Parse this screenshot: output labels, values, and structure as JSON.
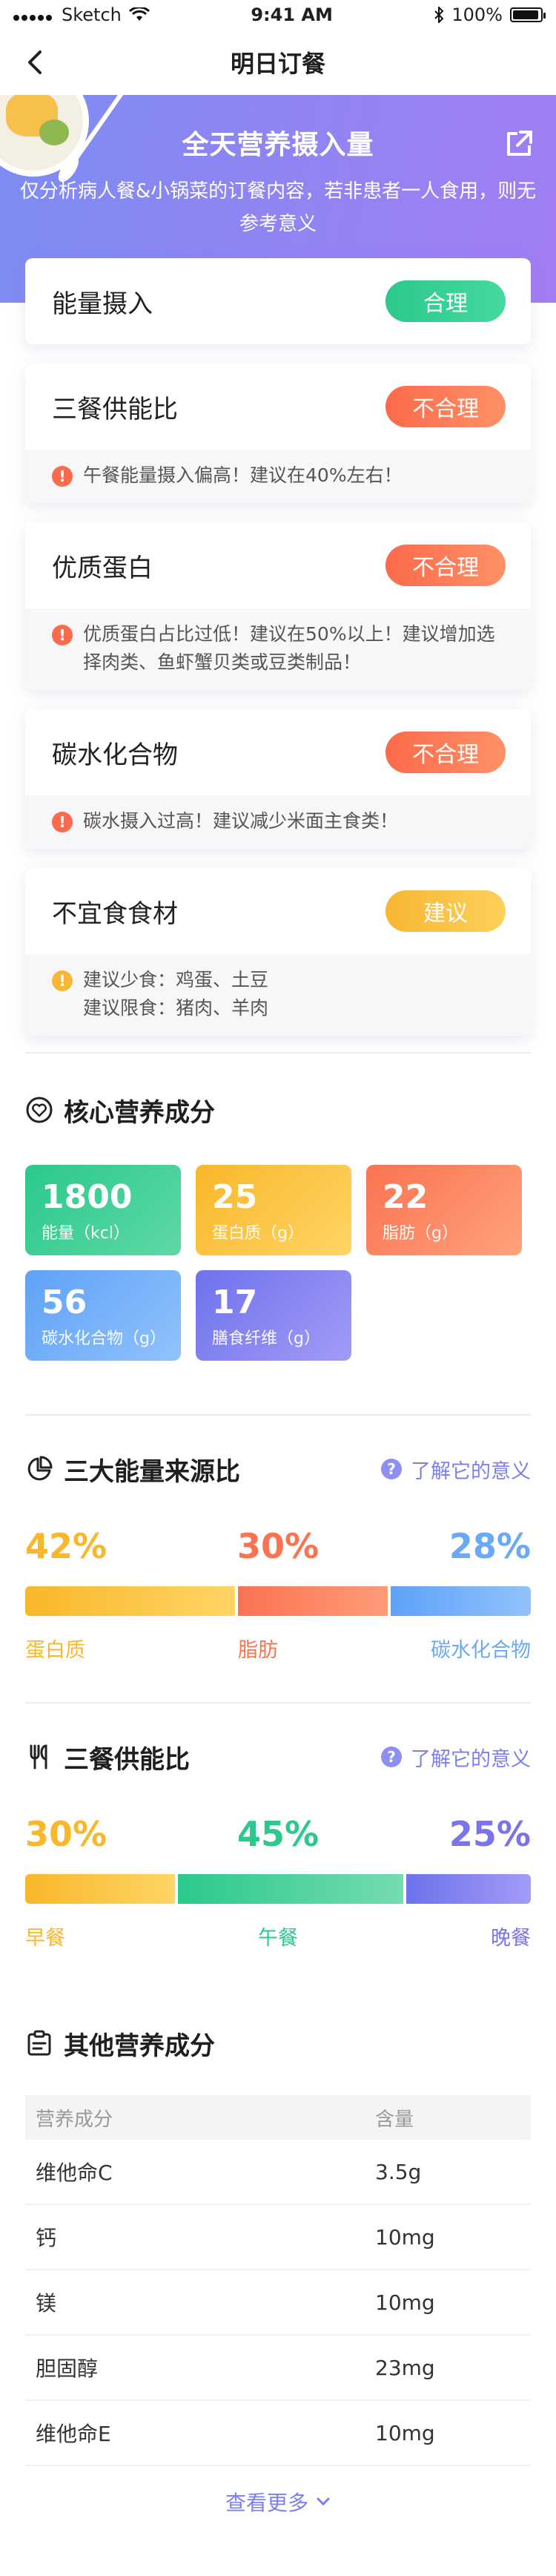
{
  "status_bar": {
    "carrier": "Sketch",
    "time": "9:41 AM",
    "battery": "100%"
  },
  "nav": {
    "title": "明日订餐"
  },
  "hero": {
    "title": "全天营养摄入量",
    "desc": "仅分析病人餐&小锅菜的订餐内容，若非患者一人食用，则无参考意义"
  },
  "evaluations": [
    {
      "title": "能量摄入",
      "badge": "合理",
      "status": "good"
    },
    {
      "title": "三餐供能比",
      "badge": "不合理",
      "status": "bad",
      "note": "午餐能量摄入偏高！建议在40%左右！"
    },
    {
      "title": "优质蛋白",
      "badge": "不合理",
      "status": "bad",
      "note": "优质蛋白占比过低！建议在50%以上！建议增加选择肉类、鱼虾蟹贝类或豆类制品！"
    },
    {
      "title": "碳水化合物",
      "badge": "不合理",
      "status": "bad",
      "note": "碳水摄入过高！建议减少米面主食类！"
    },
    {
      "title": "不宜食食材",
      "badge": "建议",
      "status": "warn",
      "note_line1": "建议少食：鸡蛋、土豆",
      "note_line2": "建议限食：猪肉、羊肉"
    }
  ],
  "core": {
    "title": "核心营养成分",
    "tiles": [
      {
        "value": "1800",
        "label": "能量（kcl）"
      },
      {
        "value": "25",
        "label": "蛋白质（g）"
      },
      {
        "value": "22",
        "label": "脂肪（g）"
      },
      {
        "value": "56",
        "label": "碳水化合物（g）"
      },
      {
        "value": "17",
        "label": "膳食纤维（g）"
      }
    ]
  },
  "energy_source": {
    "title": "三大能量来源比",
    "learn": "了解它的意义",
    "items": [
      {
        "pct": "42%",
        "label": "蛋白质",
        "fraction": 0.42,
        "color": "#f9b72a"
      },
      {
        "pct": "30%",
        "label": "脂肪",
        "fraction": 0.3,
        "color": "#fb7351"
      },
      {
        "pct": "28%",
        "label": "碳水化合物",
        "fraction": 0.28,
        "color": "#6aa8f8"
      }
    ]
  },
  "meal_ratio": {
    "title": "三餐供能比",
    "learn": "了解它的意义",
    "items": [
      {
        "pct": "30%",
        "label": "早餐",
        "fraction": 0.3,
        "color": "#f9b72a"
      },
      {
        "pct": "45%",
        "label": "午餐",
        "fraction": 0.45,
        "color": "#2bc98b"
      },
      {
        "pct": "25%",
        "label": "晚餐",
        "fraction": 0.25,
        "color": "#7b73ee"
      }
    ]
  },
  "other": {
    "title": "其他营养成分",
    "columns": [
      "营养成分",
      "含量"
    ],
    "rows": [
      [
        "维他命C",
        "3.5g"
      ],
      [
        "钙",
        "10mg"
      ],
      [
        "镁",
        "10mg"
      ],
      [
        "胆固醇",
        "23mg"
      ],
      [
        "维他命E",
        "10mg"
      ]
    ],
    "more": "查看更多"
  }
}
